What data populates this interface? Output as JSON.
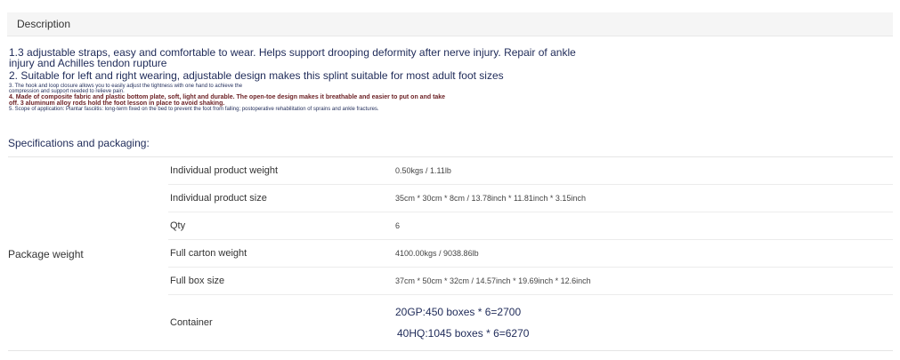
{
  "section": {
    "title": "Description"
  },
  "description": {
    "line1a": "1.3 adjustable straps, easy and comfortable to wear. Helps support drooping deformity after nerve injury. Repair of ankle",
    "line1b": "injury and Achilles tendon rupture",
    "line2": "2. Suitable for left and right wearing, adjustable design makes this splint suitable for most adult foot sizes",
    "line3a": "3. The hook and loop closure allows you to easily adjust the tightness with one hand to achieve the",
    "line3b": "compression and support needed to relieve pain.",
    "line4a": "4. Made of composite fabric and plastic bottom plate, soft, light and durable. The open-toe design makes it breathable and easier to put on and take",
    "line4b": "off. 3 aluminum alloy rods hold the foot lesson in place to avoid shaking.",
    "line5": "5. Scope of application: Plantar fasciitis: long-term fixed on the bed to prevent the foot from falling; postoperative rehabilitation of sprains and ankle fractures."
  },
  "specs": {
    "title": "Specifications and packaging:",
    "group_label": "Package weight",
    "rows": [
      {
        "key": "Individual product weight",
        "value": "0.50kgs / 1.11lb"
      },
      {
        "key": "Individual product size",
        "value": "35cm * 30cm * 8cm / 13.78inch * 11.81inch * 3.15inch"
      },
      {
        "key": "Qty",
        "value": "6"
      },
      {
        "key": "Full carton weight",
        "value": "4100.00kgs / 9038.86lb"
      },
      {
        "key": "Full box size",
        "value": "37cm * 50cm * 32cm / 14.57inch * 19.69inch * 12.6inch"
      }
    ],
    "container": {
      "key": "Container",
      "line1": "20GP:450 boxes * 6=2700",
      "line2": "40HQ:1045 boxes * 6=6270"
    }
  }
}
